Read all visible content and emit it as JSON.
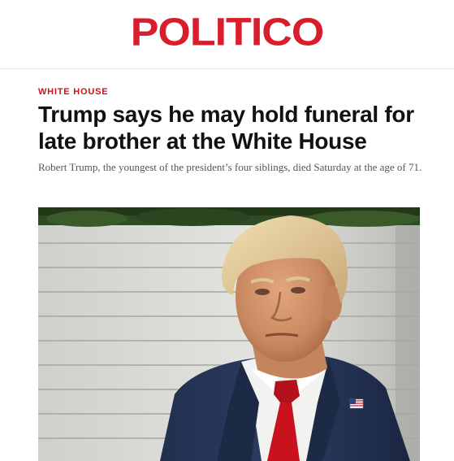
{
  "brand": {
    "logo_text": "POLITICO",
    "color": "#d81e2d"
  },
  "article": {
    "section_label": "WHITE HOUSE",
    "section_color": "#c4161c",
    "headline": "Trump says he may hold funeral for late brother at the White House",
    "dek": "Robert Trump, the youngest of the president’s four siblings, died Saturday at the age of 71."
  },
  "photo": {
    "subject": "portrait photo of Donald Trump in a navy suit, white shirt and red tie with an American flag lapel pin, against a white siding background with green foliage above",
    "icons": [
      "flag-pin-icon"
    ]
  }
}
